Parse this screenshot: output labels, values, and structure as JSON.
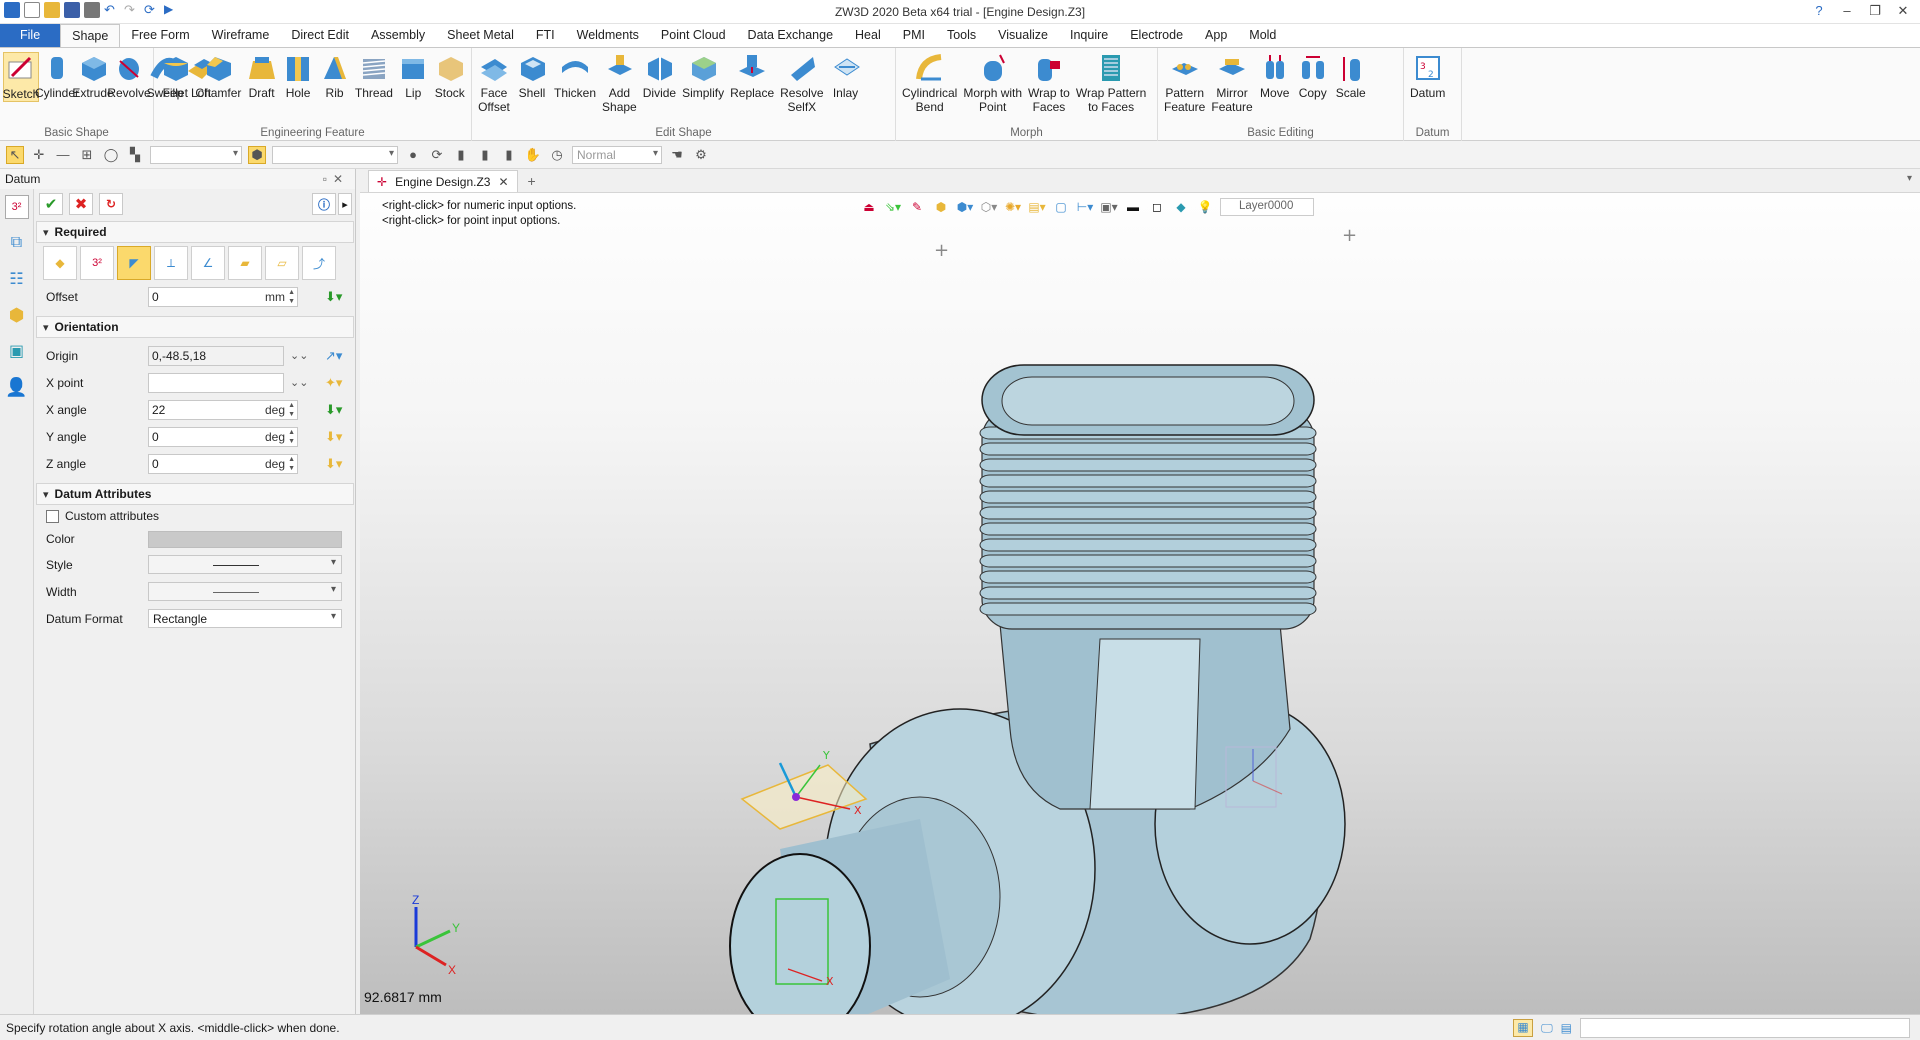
{
  "window": {
    "title": "ZW3D 2020 Beta x64 trial - [Engine Design.Z3]"
  },
  "menu": {
    "tabs": [
      "File",
      "Shape",
      "Free Form",
      "Wireframe",
      "Direct Edit",
      "Assembly",
      "Sheet Metal",
      "FTI",
      "Weldments",
      "Point Cloud",
      "Data Exchange",
      "Heal",
      "PMI",
      "Tools",
      "Visualize",
      "Inquire",
      "Electrode",
      "App",
      "Mold"
    ],
    "active": "Shape"
  },
  "ribbon": {
    "groups": [
      {
        "label": "Basic Shape",
        "buttons": [
          "Sketch",
          "Cylinder",
          "Extrude",
          "Revolve",
          "Sweep",
          "Loft"
        ]
      },
      {
        "label": "Engineering Feature",
        "buttons": [
          "Fillet",
          "Chamfer",
          "Draft",
          "Hole",
          "Rib",
          "Thread",
          "Lip",
          "Stock"
        ]
      },
      {
        "label": "Edit Shape",
        "buttons": [
          "Face\nOffset",
          "Shell",
          "Thicken",
          "Add\nShape",
          "Divide",
          "Simplify",
          "Replace",
          "Resolve\nSelfX",
          "Inlay"
        ]
      },
      {
        "label": "Morph",
        "buttons": [
          "Cylindrical\nBend",
          "Morph with\nPoint",
          "Wrap to\nFaces",
          "Wrap Pattern\nto Faces"
        ]
      },
      {
        "label": "Basic Editing",
        "buttons": [
          "Pattern\nFeature",
          "Mirror\nFeature",
          "Move",
          "Copy",
          "Scale"
        ]
      },
      {
        "label": "Datum",
        "buttons": [
          "Datum"
        ]
      }
    ]
  },
  "toolbar": {
    "render_mode": "Normal"
  },
  "panel": {
    "title": "Datum",
    "sections": {
      "required": "Required",
      "orientation": "Orientation",
      "attributes": "Datum Attributes"
    },
    "offset": {
      "label": "Offset",
      "value": "0",
      "unit": "mm"
    },
    "origin": {
      "label": "Origin",
      "value": "0,-48.5,18"
    },
    "xpoint": {
      "label": "X point",
      "value": ""
    },
    "xangle": {
      "label": "X angle",
      "value": "22",
      "unit": "deg"
    },
    "yangle": {
      "label": "Y angle",
      "value": "0",
      "unit": "deg"
    },
    "zangle": {
      "label": "Z angle",
      "value": "0",
      "unit": "deg"
    },
    "custom_attributes": "Custom attributes",
    "color_label": "Color",
    "style_label": "Style",
    "width_label": "Width",
    "format": {
      "label": "Datum Format",
      "value": "Rectangle"
    }
  },
  "document": {
    "tab": "Engine Design.Z3"
  },
  "viewport": {
    "hint1": "<right-click> for numeric input options.",
    "hint2": "<right-click> for point input options.",
    "layer": "Layer0000",
    "scale_text": "92.6817 mm",
    "axis": {
      "x": "X",
      "y": "Y",
      "z": "Z"
    }
  },
  "status": {
    "message": "Specify rotation angle about X axis.  <middle-click> when done."
  },
  "colors": {
    "part": "#a9c8d6",
    "accent": "#2b6cc4",
    "highlight": "#fbd96c"
  }
}
